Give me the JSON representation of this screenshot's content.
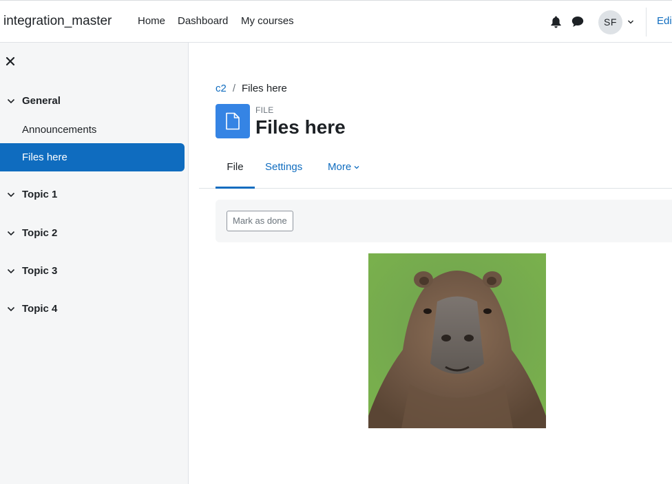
{
  "navbar": {
    "site_name": "integration_master",
    "links": [
      "Home",
      "Dashboard",
      "My courses"
    ],
    "user_initials": "SF",
    "edit_mode_label": "Edi",
    "icons": [
      "bell-icon",
      "chat-icon",
      "chevron-down-icon"
    ]
  },
  "drawer": {
    "close_icon": "close-icon",
    "sections": [
      {
        "label": "General",
        "activities": [
          "Announcements",
          "Files here"
        ]
      },
      {
        "label": "Topic 1"
      },
      {
        "label": "Topic 2"
      },
      {
        "label": "Topic 3"
      },
      {
        "label": "Topic 4"
      }
    ],
    "active_activity": "Files here"
  },
  "main": {
    "breadcrumb": [
      "c2",
      "Files here"
    ],
    "breadcrumb_separator": "/",
    "module_type": "FILE",
    "title": "Files here",
    "tabs": [
      {
        "label": "File",
        "active": true
      },
      {
        "label": "Settings"
      },
      {
        "label": "More"
      }
    ],
    "mark_as_done_label": "Mark as done",
    "image_subject": "capybara-photo"
  },
  "colors": {
    "accent": "#0f6cbf",
    "file_icon_bg": "#3584e4",
    "drawer_bg": "#f5f6f7"
  }
}
